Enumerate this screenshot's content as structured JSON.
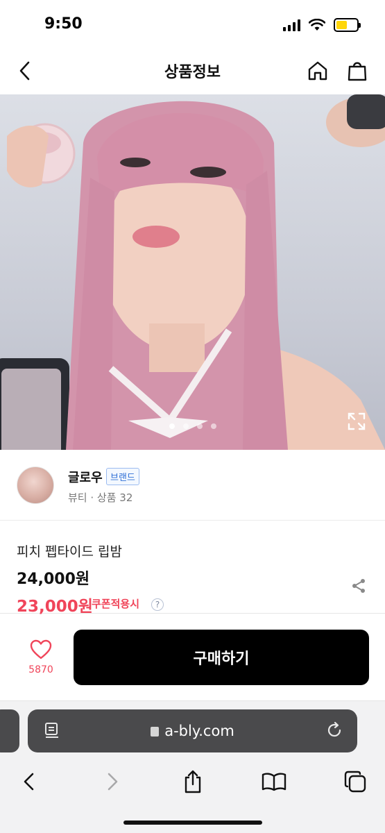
{
  "status": {
    "time": "9:50"
  },
  "header": {
    "title": "상품정보"
  },
  "brand": {
    "name": "글로우",
    "tag": "브랜드",
    "sub": "뷰티 · 상품 32"
  },
  "product": {
    "name": "피치 펩타이드 립밤",
    "price_original": "24,000원",
    "price_coupon": "23,000원",
    "coupon_label": "쿠폰적용시",
    "help": "?"
  },
  "purchase": {
    "like_count": "5870",
    "buy_label": "구매하기"
  },
  "browser": {
    "url": "a-bly.com"
  },
  "carousel": {
    "count": 4,
    "active_index": 0
  },
  "colors": {
    "accent": "#f0455a",
    "buy_button": "#000000",
    "brand_tag": "#2f6fd6"
  },
  "icons": {
    "back": "chevron-left-icon",
    "home": "home-icon",
    "bag": "shopping-bag-icon",
    "expand": "expand-icon",
    "share": "share-icon",
    "like": "heart-icon",
    "reader": "reader-icon",
    "reload": "reload-icon",
    "lock": "lock-icon",
    "nav_back": "chevron-left-icon",
    "nav_forward": "chevron-right-icon",
    "share_sheet": "share-sheet-icon",
    "bookmarks": "book-icon",
    "tabs": "tabs-icon"
  }
}
